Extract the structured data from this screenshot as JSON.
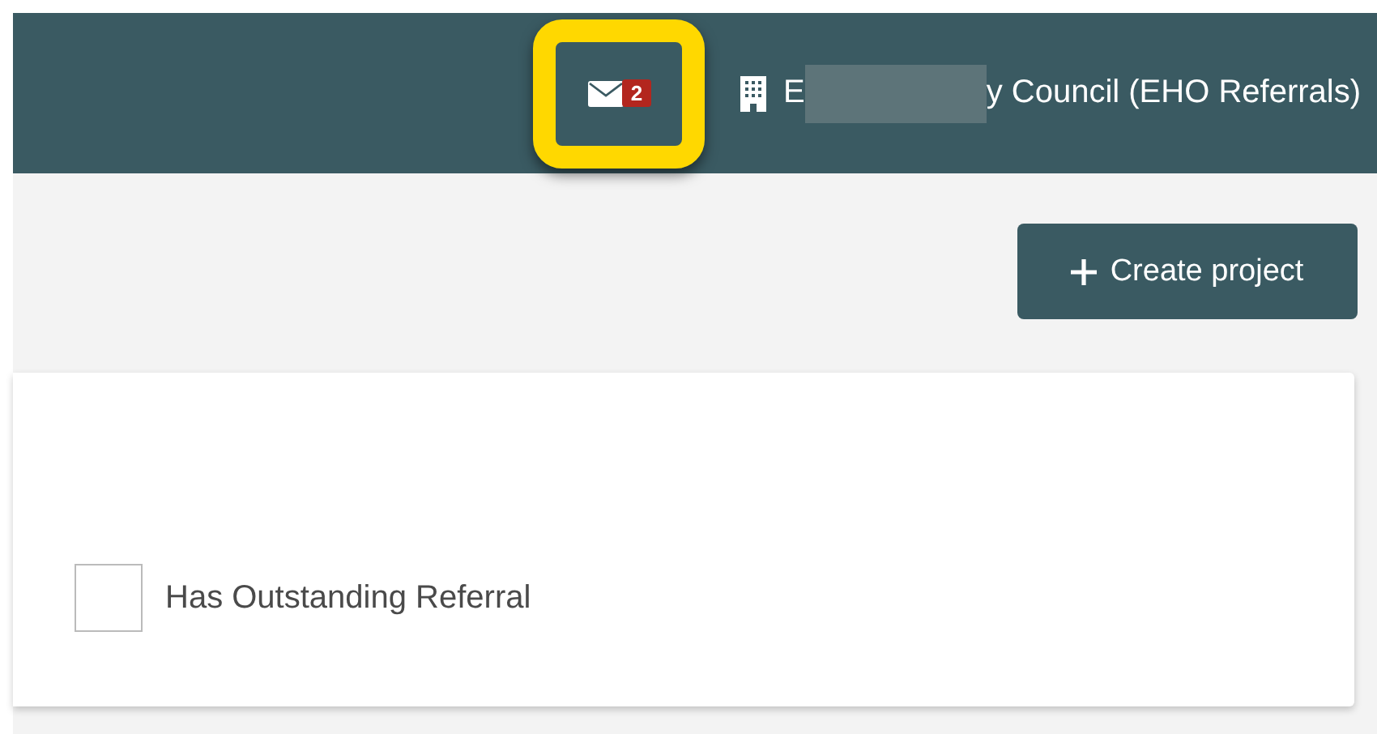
{
  "header": {
    "messages": {
      "unread_count": "2",
      "highlighted": true
    },
    "organisation": {
      "parts": [
        {
          "kind": "text",
          "text": "E"
        },
        {
          "kind": "redacted"
        },
        {
          "kind": "text",
          "text": "y Council (EHO Referrals)"
        }
      ]
    }
  },
  "toolbar": {
    "create_button": {
      "label": "Create project"
    }
  },
  "filters": [
    {
      "label": "Has Outstanding Referral",
      "checked": false
    }
  ]
}
